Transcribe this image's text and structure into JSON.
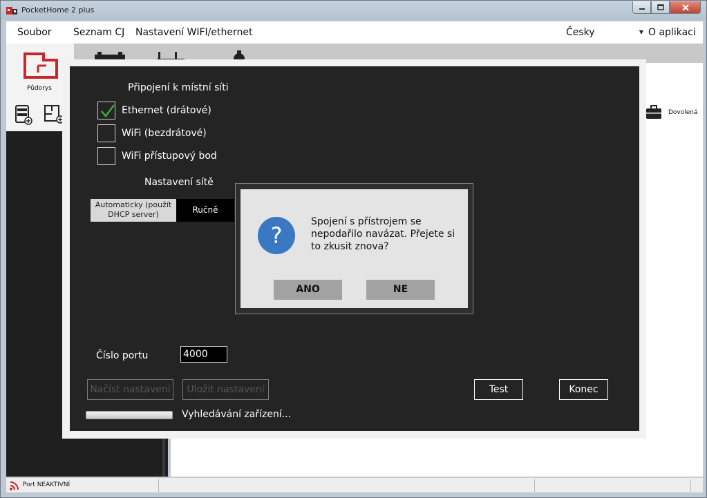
{
  "window": {
    "title": "PocketHome 2 plus"
  },
  "menu": {
    "items": [
      "Soubor",
      "Seznam CJ",
      "Nastavení WIFI/ethernet"
    ],
    "language": "Česky",
    "about": "O aplikaci"
  },
  "ribbon": {
    "pudorys": "Půdorys",
    "dovolena": "Dovolená"
  },
  "status": {
    "port": "Port NEAKTIVNÍ"
  },
  "settings": {
    "connection_heading": "Připojení k místní síti",
    "options": [
      {
        "label": "Ethernet (drátové)",
        "checked": true
      },
      {
        "label": "WiFi (bezdrátové)",
        "checked": false
      },
      {
        "label": "WiFi přístupový bod",
        "checked": false
      }
    ],
    "network_heading": "Nastavení sítě",
    "auto_label": "Automaticky (použít DHCP server)",
    "manual_label": "Ručně",
    "port_label": "Číslo portu",
    "port_value": "4000",
    "load_button": "Načíst nastavení",
    "save_button": "Uložit nastavení",
    "test_button": "Test",
    "exit_button": "Konec",
    "searching_text": "Vyhledávání zařízení..."
  },
  "message_box": {
    "text": "Spojení s přístrojem se nepodařilo navázat. Přejete si to zkusit znova?",
    "yes": "ANO",
    "no": "NE",
    "icon": "question-icon",
    "icon_color": "#3b78c3"
  },
  "colors": {
    "accent_red": "#c8272c",
    "dialog_bg": "#242424",
    "check_green": "#3fae3f"
  }
}
